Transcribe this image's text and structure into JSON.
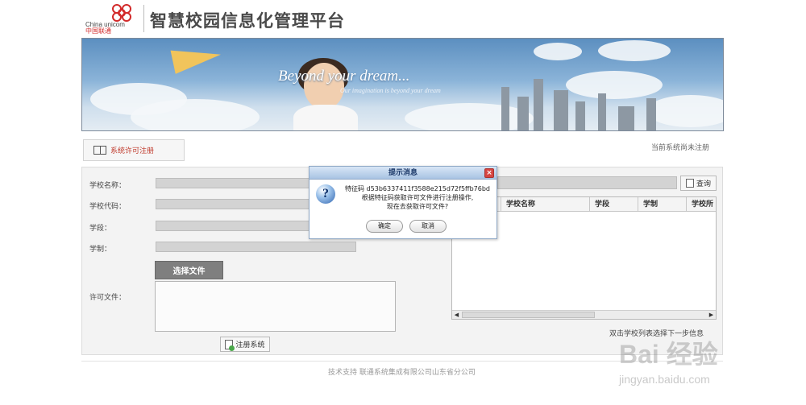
{
  "header": {
    "logo_text_en": "China unicom",
    "logo_text_cn": "中国联通",
    "title": "智慧校园信息化管理平台"
  },
  "banner": {
    "slogan": "Beyond your dream...",
    "subtitle": "Our imagination is beyond your dream"
  },
  "tab": {
    "label": "系统许可注册",
    "icon": "panel-icon"
  },
  "status": {
    "registration": "当前系统尚未注册"
  },
  "form": {
    "school_name_label": "学校名称：",
    "school_code_label": "学校代码：",
    "stage_label": "学段：",
    "system_label": "学制：",
    "choose_file_label": "选择文件",
    "license_file_label": "许可文件：",
    "register_label": "注册系统",
    "school_name_value": "",
    "school_code_value": "",
    "stage_value": "",
    "system_value": "",
    "license_file_value": ""
  },
  "search": {
    "value": "",
    "query_label": "查询"
  },
  "table": {
    "columns": [
      "学校名称",
      "学段",
      "学制",
      "学校所"
    ],
    "hint": "双击学校列表选择下一步信息"
  },
  "footer": {
    "text": "技术支持  联通系统集成有限公司山东省分公司"
  },
  "dialog": {
    "title": "提示消息",
    "line1": "特征码  d53b6337411f3588e215d72f5ffb76bd",
    "line2": "根据特征码获取许可文件进行注册操作,",
    "line3": "现在去获取许可文件?",
    "ok_label": "确定",
    "cancel_label": "取消"
  },
  "watermark": {
    "text": "Bai 经验",
    "url": "jingyan.baidu.com"
  },
  "colors": {
    "accent": "#c0392b",
    "dialog_title": "#a8c3e3",
    "button_dark": "#7f7f7f"
  }
}
